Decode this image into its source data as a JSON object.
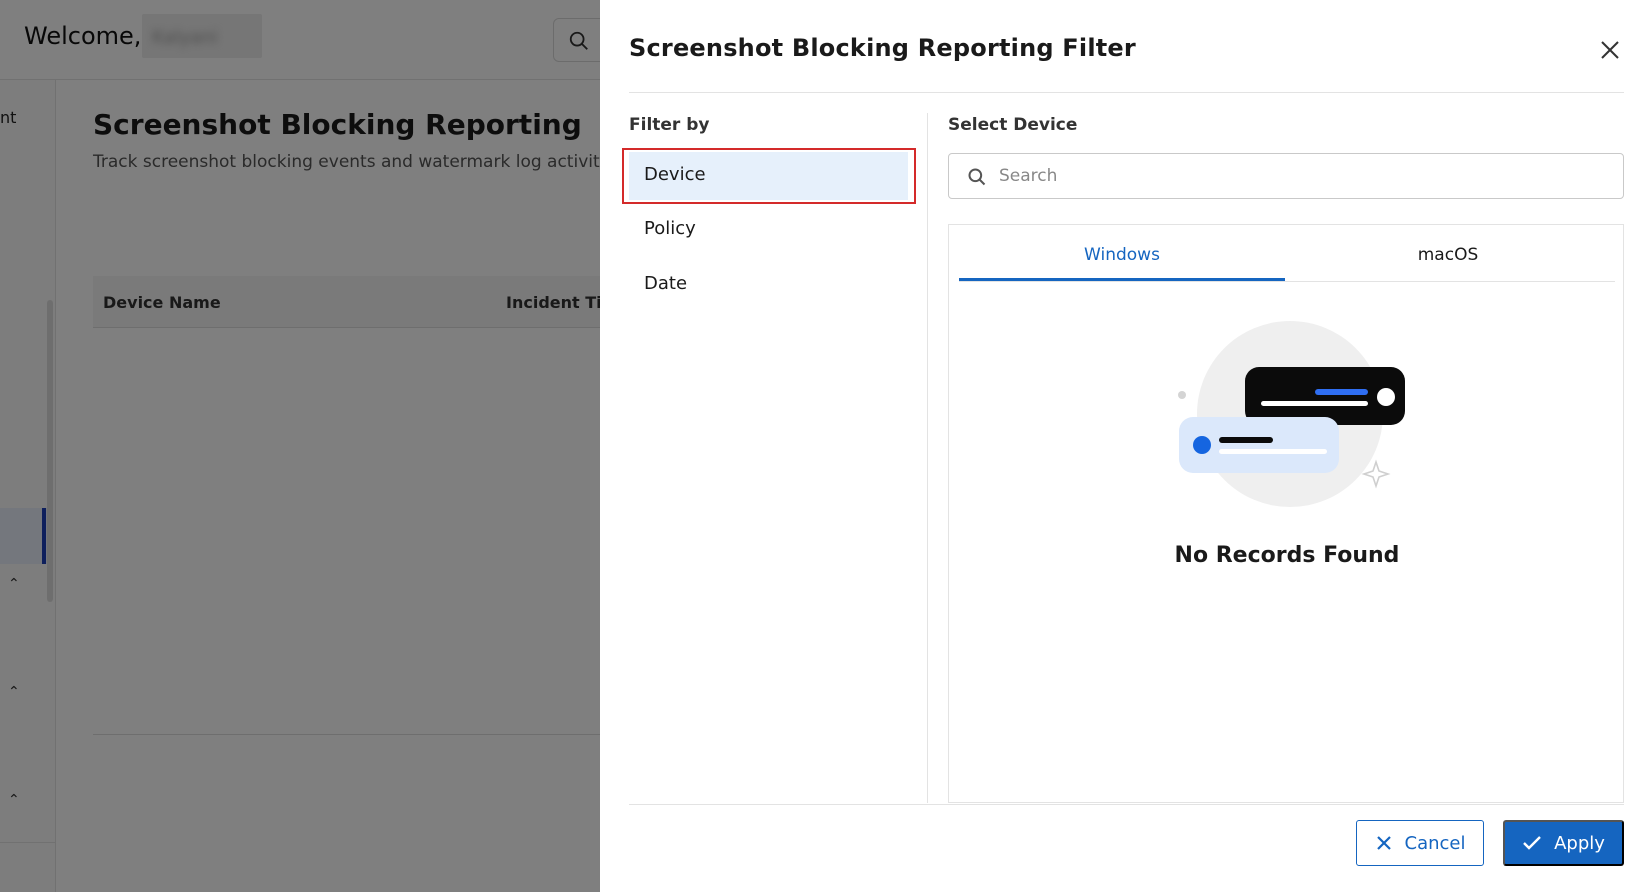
{
  "background": {
    "welcome": "Welcome,",
    "user_name": "Kalyani",
    "sidebar_partial_text": "nt",
    "page_title": "Screenshot Blocking Reporting",
    "page_subtitle": "Track screenshot blocking events and watermark log activity",
    "table_columns": [
      "Device Name",
      "Incident Ti"
    ],
    "sidebar_chevrons": [
      "^",
      "^",
      "^"
    ]
  },
  "drawer": {
    "title": "Screenshot Blocking Reporting Filter",
    "close_icon": "close-icon",
    "filter_by_label": "Filter by",
    "filter_items": [
      {
        "label": "Device",
        "active": true
      },
      {
        "label": "Policy",
        "active": false
      },
      {
        "label": "Date",
        "active": false
      }
    ],
    "select_device_label": "Select Device",
    "search": {
      "placeholder": "Search",
      "value": ""
    },
    "tabs": [
      {
        "label": "Windows",
        "active": true
      },
      {
        "label": "macOS",
        "active": false
      }
    ],
    "empty_state": {
      "message": "No Records Found",
      "illustration": "empty-records-illustration"
    },
    "buttons": {
      "cancel": "Cancel",
      "apply": "Apply"
    }
  },
  "colors": {
    "accent": "#1565c0",
    "active_item_bg": "#e6f0fb",
    "highlight_border": "#d42a2a",
    "overlay": "rgba(0,0,0,0.5)"
  }
}
